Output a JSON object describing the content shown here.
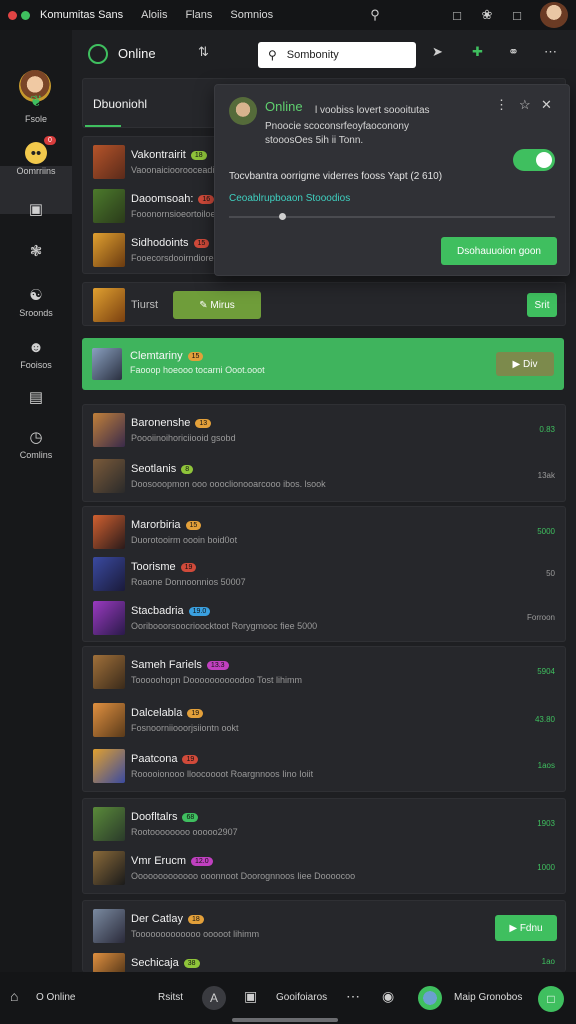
{
  "topbar": {
    "app_title": "Komumitas Sans",
    "menu": [
      "Aloiis",
      "Flans",
      "Somnios"
    ]
  },
  "rail": {
    "items": [
      {
        "label": "Fsole",
        "icon": "leaf-icon"
      },
      {
        "label": "Oomrriins",
        "icon": "chat-bubble-icon",
        "badge": "0"
      },
      {
        "label": "",
        "icon": "image-icon"
      },
      {
        "label": "",
        "icon": "puzzle-icon"
      },
      {
        "label": "Sroonds",
        "icon": "gamepad-icon"
      },
      {
        "label": "Fooisos",
        "icon": "people-icon"
      },
      {
        "label": "",
        "icon": "document-icon"
      },
      {
        "label": "Comlins",
        "icon": "clock-icon"
      }
    ]
  },
  "header": {
    "status": "Online",
    "search_placeholder": "Sombonity"
  },
  "tab": {
    "label": "Dbuoniohl"
  },
  "popup": {
    "status": "Online",
    "line1": "l voobiss lovert soooitutas",
    "line2": "Pnoocie scoconsrfeoyfaoconony",
    "line3": "stooosOes 5ih ii Tonn.",
    "desc": "Tocvbantra oorrigme viderres fooss Yapt (2 610)",
    "link": "Ceoablrupboaon Stooodios",
    "button": "Dsohauuoion goon"
  },
  "group1": [
    {
      "name": "Vakontrairit",
      "tag": "18",
      "tag_color": "#8fc43a",
      "sub": "Vaoonaicioorooceadio"
    },
    {
      "name": "Daoomsoah:",
      "tag": "16",
      "tag_color": "#d04a3a",
      "sub": "Fooonornsioeortoiloerssol"
    },
    {
      "name": "Sidhodoints",
      "tag": "15",
      "tag_color": "#d04a3a",
      "sub": "Fooecorsdooirndioreor"
    }
  ],
  "group2": {
    "name": "Tiurst",
    "chip": "Mirus",
    "button": "Srit"
  },
  "highlight": {
    "name": "Clemtariny",
    "tag": "15",
    "sub": "Faooop hoeooo tocarni Ooot.ooot",
    "button": "Div"
  },
  "group3": [
    {
      "name": "Baronenshe",
      "tag": "13",
      "tag_color": "#e3a03a",
      "sub": "Poooiinoihoriciiooid gsobd",
      "meta": "0.83"
    },
    {
      "name": "Seotlanis",
      "tag": "8",
      "tag_color": "#8fc43a",
      "sub": "Doosooopmon ooo oooclionooarcooo ibos. lsook",
      "meta": "13ak"
    }
  ],
  "group4": [
    {
      "name": "Marorbiria",
      "tag": "15",
      "tag_color": "#e3a03a",
      "sub": "Duorotooirm oooin boid0ot",
      "meta": "5000"
    },
    {
      "name": "Toorisme",
      "tag": "19",
      "tag_color": "#d04a3a",
      "sub": "Roaone Donnoonnios 50007",
      "meta": "50"
    },
    {
      "name": "Stacbadria",
      "tag": "19.0",
      "tag_color": "#3aa0e0",
      "sub": "Ooribooorsoocrioocktoot Rorygmooc fiee 5000",
      "meta": "Forroon"
    }
  ],
  "group5": [
    {
      "name": "Sameh Fariels",
      "tag": "13.3",
      "tag_color": "#c040c0",
      "sub": "Tooooohopn Doooooooooodoo Tost lihimm",
      "meta": "5904"
    },
    {
      "name": "Dalcelabla",
      "tag": "19",
      "tag_color": "#e3a03a",
      "sub": "Fosnoorniiooorjsiiontn ookt",
      "meta": "43.80"
    },
    {
      "name": "Paatcona",
      "tag": "19",
      "tag_color": "#d04a3a",
      "sub": "Rooooionooo lloocoooot Roargnnoos Iino Ioiit",
      "meta": "1aos"
    }
  ],
  "group6": [
    {
      "name": "Doofltalrs",
      "tag": "68",
      "tag_color": "#3fbf5f",
      "sub": "Rootoooooooo ooooo2907",
      "meta": "1903"
    },
    {
      "name": "Vmr Erucm",
      "tag": "12.0",
      "tag_color": "#c040c0",
      "sub": "Ooooooooooooo ooonnoot Doorognnoos Iiee Doooocoo",
      "meta": "1000"
    }
  ],
  "group7": [
    {
      "name": "Der Catlay",
      "tag": "18",
      "tag_color": "#e3a03a",
      "sub": "Tooooooooooooo ooooot lihimm",
      "meta": ""
    },
    {
      "name": "Sechicaja",
      "tag": "38",
      "tag_color": "#8fc43a",
      "sub": "",
      "meta": "1ao"
    }
  ],
  "group7_button": "Fdnu",
  "bottombar": {
    "online": "O Online",
    "item2": "Rsitst",
    "item3": "Gooifoiaros",
    "item4": "Maip Gronobos"
  }
}
